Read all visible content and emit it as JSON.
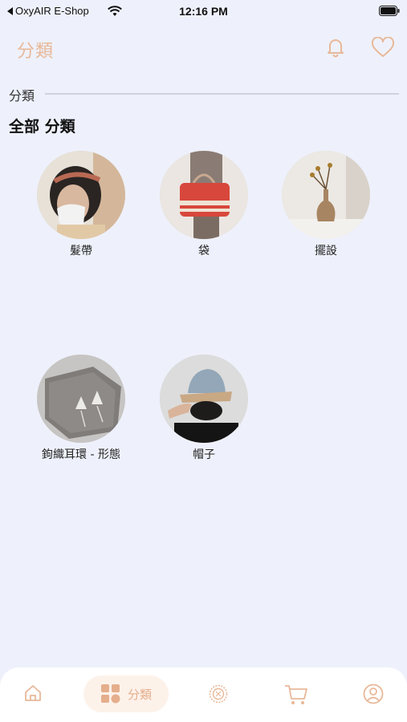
{
  "status_bar": {
    "back_app": "OxyAIR E-Shop",
    "time": "12:16 PM"
  },
  "header": {
    "title": "分類",
    "bell_icon": "bell-icon",
    "heart_icon": "heart-icon"
  },
  "section": {
    "label": "分類",
    "all_title": "全部 分類"
  },
  "categories": [
    {
      "label": "髮帶"
    },
    {
      "label": "袋"
    },
    {
      "label": "擺設"
    },
    {
      "label": "鉤織耳環 - 形態"
    },
    {
      "label": "帽子"
    }
  ],
  "tabbar": {
    "active_label": "分類",
    "items": [
      "home-icon",
      "category-icon",
      "coin-icon",
      "cart-icon",
      "profile-icon"
    ]
  },
  "colors": {
    "accent": "#e8b899",
    "background": "#eef1fb"
  }
}
